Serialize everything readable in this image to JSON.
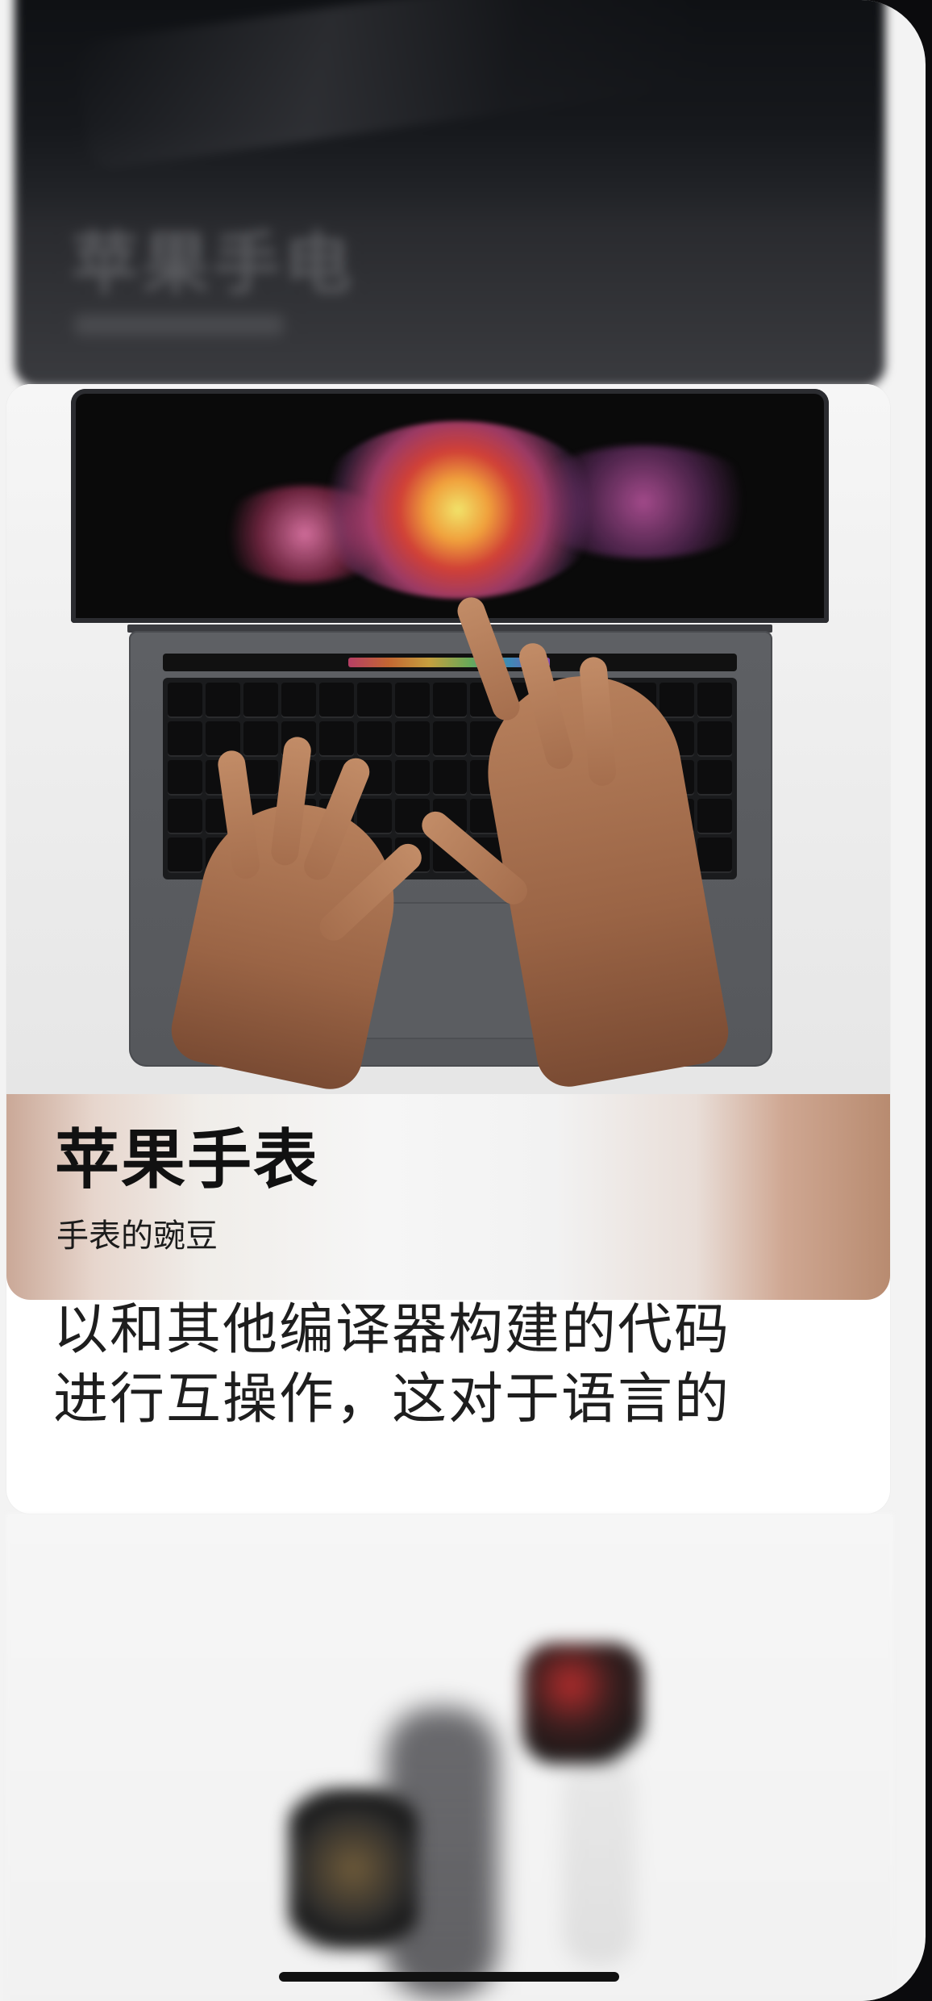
{
  "background_cards": {
    "top_blurred_title": "苹果手电"
  },
  "main_card": {
    "title": "苹果手表",
    "subtitle": "手表的豌豆",
    "body_lines": [
      "以和其他编译器构建的代码",
      "进行互操作，这对于语言的"
    ]
  }
}
